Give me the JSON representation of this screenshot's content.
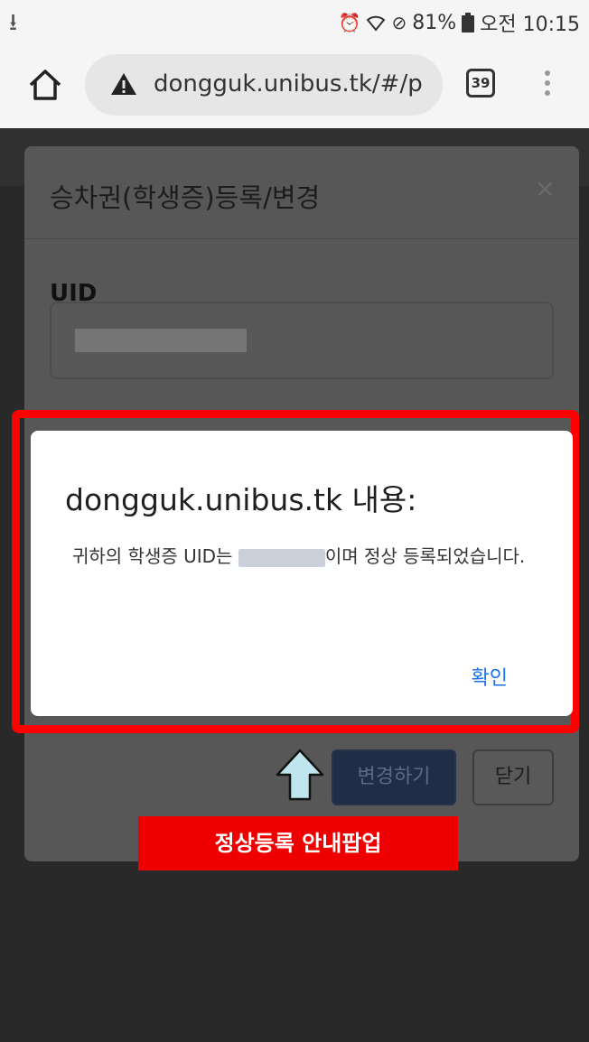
{
  "status_bar": {
    "battery": "81%",
    "time": "오전 10:15"
  },
  "browser": {
    "url": "dongguk.unibus.tk/#/p",
    "tab_count": "39"
  },
  "modal": {
    "title": "승차권(학생증)등록/변경",
    "close_symbol": "×",
    "uid_label": "UID",
    "change_button": "변경하기",
    "close_button": "닫기"
  },
  "alert": {
    "title": "dongguk.unibus.tk 내용:",
    "message_before": "귀하의 학생증 UID는 ",
    "message_after": "이며 정상 등록되었습니다.",
    "ok_button": "확인"
  },
  "annotation": {
    "label": "정상등록 안내팝업"
  }
}
